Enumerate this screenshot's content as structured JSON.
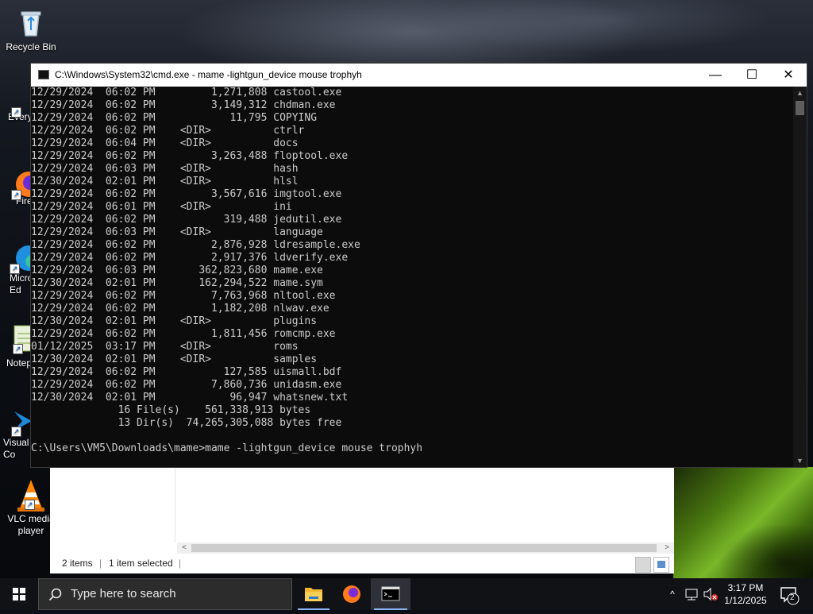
{
  "desktop": {
    "icons": [
      {
        "label": "Recycle Bin"
      },
      {
        "label": "Every"
      },
      {
        "label": "Fire"
      },
      {
        "label": "Micro Ed"
      },
      {
        "label": "Notep"
      },
      {
        "label": "Visual Co"
      },
      {
        "label": "VLC media player"
      }
    ]
  },
  "cmd": {
    "title": "C:\\Windows\\System32\\cmd.exe - mame  -lightgun_device mouse trophyh",
    "lines": [
      "12/29/2024  06:02 PM         1,271,808 castool.exe",
      "12/29/2024  06:02 PM         3,149,312 chdman.exe",
      "12/29/2024  06:02 PM            11,795 COPYING",
      "12/29/2024  06:02 PM    <DIR>          ctrlr",
      "12/29/2024  06:04 PM    <DIR>          docs",
      "12/29/2024  06:02 PM         3,263,488 floptool.exe",
      "12/29/2024  06:03 PM    <DIR>          hash",
      "12/30/2024  02:01 PM    <DIR>          hlsl",
      "12/29/2024  06:02 PM         3,567,616 imgtool.exe",
      "12/29/2024  06:01 PM    <DIR>          ini",
      "12/29/2024  06:02 PM           319,488 jedutil.exe",
      "12/29/2024  06:03 PM    <DIR>          language",
      "12/29/2024  06:02 PM         2,876,928 ldresample.exe",
      "12/29/2024  06:02 PM         2,917,376 ldverify.exe",
      "12/29/2024  06:03 PM       362,823,680 mame.exe",
      "12/30/2024  02:01 PM       162,294,522 mame.sym",
      "12/29/2024  06:02 PM         7,763,968 nltool.exe",
      "12/29/2024  06:02 PM         1,182,208 nlwav.exe",
      "12/30/2024  02:01 PM    <DIR>          plugins",
      "12/29/2024  06:02 PM         1,811,456 romcmp.exe",
      "01/12/2025  03:17 PM    <DIR>          roms",
      "12/30/2024  02:01 PM    <DIR>          samples",
      "12/29/2024  06:02 PM           127,585 uismall.bdf",
      "12/29/2024  06:02 PM         7,860,736 unidasm.exe",
      "12/30/2024  02:01 PM            96,947 whatsnew.txt",
      "              16 File(s)    561,338,913 bytes",
      "              13 Dir(s)  74,265,305,088 bytes free",
      "",
      "C:\\Users\\VM5\\Downloads\\mame>mame -lightgun_device mouse trophyh"
    ]
  },
  "explorer": {
    "status_items": "2 items",
    "status_selected": "1 item selected",
    "separator": "|"
  },
  "taskbar": {
    "search_placeholder": "Type here to search",
    "time": "3:17 PM",
    "date": "1/12/2025",
    "notification_count": "2"
  },
  "colors": {
    "console_bg": "#0c0c0c",
    "console_text": "#cccccc",
    "taskbar_bg": "#101216",
    "accent": "#8ab4f8"
  }
}
